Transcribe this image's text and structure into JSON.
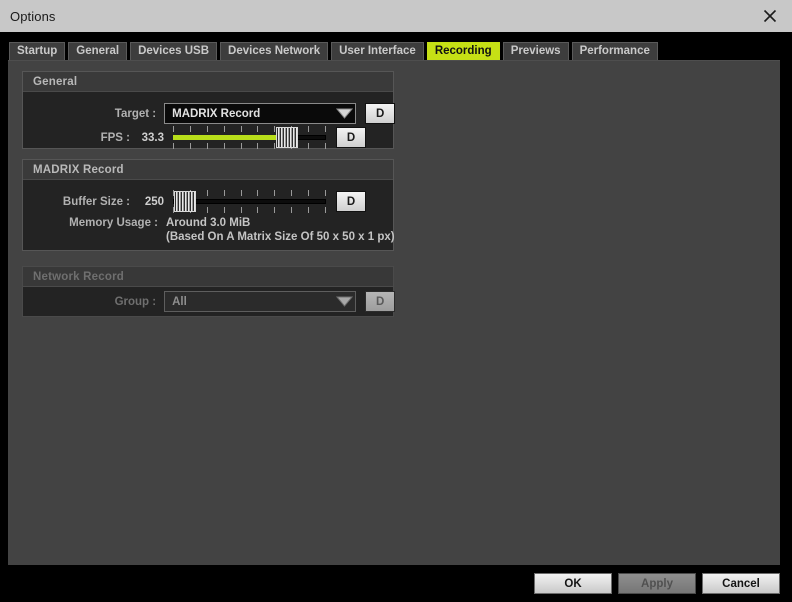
{
  "window": {
    "title": "Options",
    "close_icon": "close-icon"
  },
  "tabs": [
    {
      "label": "Startup",
      "active": false
    },
    {
      "label": "General",
      "active": false
    },
    {
      "label": "Devices USB",
      "active": false
    },
    {
      "label": "Devices Network",
      "active": false
    },
    {
      "label": "User Interface",
      "active": false
    },
    {
      "label": "Recording",
      "active": true
    },
    {
      "label": "Previews",
      "active": false
    },
    {
      "label": "Performance",
      "active": false
    }
  ],
  "groups": {
    "general": {
      "title": "General",
      "target": {
        "label": "Target :",
        "value": "MADRIX Record",
        "arrow_icon": "chevron-down-icon",
        "default_button": "D"
      },
      "fps": {
        "label": "FPS :",
        "value": "33.3",
        "fill_percent": 79,
        "thumb_percent": 79,
        "default_button": "D"
      }
    },
    "madrix_record": {
      "title": "MADRIX Record",
      "buffer_size": {
        "label": "Buffer Size :",
        "value": "250",
        "fill_percent": 0,
        "thumb_percent": 1,
        "default_button": "D"
      },
      "memory_usage": {
        "label": "Memory Usage :",
        "line1": "Around 3.0 MiB",
        "line2": "(Based On A Matrix Size Of 50 x 50 x 1 px)"
      }
    },
    "network_record": {
      "title": "Network Record",
      "group": {
        "label": "Group :",
        "value": "All",
        "arrow_icon": "chevron-down-icon",
        "default_button": "D"
      }
    }
  },
  "footer": {
    "ok": "OK",
    "apply": "Apply",
    "cancel": "Cancel"
  },
  "colors": {
    "accent": "#c6e015",
    "slider_fill": "#b8de1a",
    "titlebar": "#c8c8c8",
    "panel": "#434343",
    "group_bg": "#232323"
  }
}
